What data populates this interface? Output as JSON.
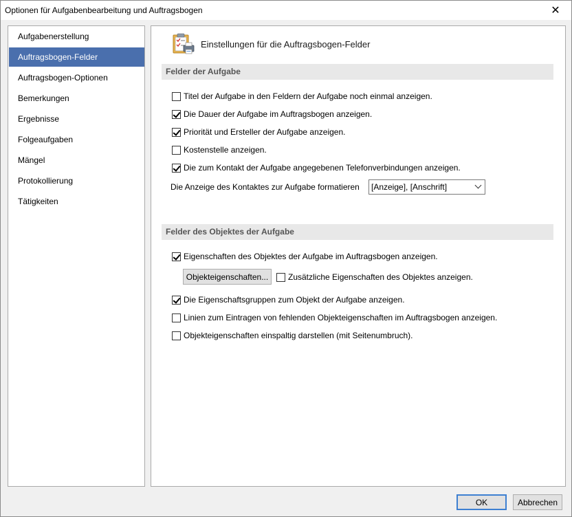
{
  "window": {
    "title": "Optionen für Aufgabenbearbeitung und Auftragsbogen",
    "close_glyph": "✕"
  },
  "sidebar": {
    "items": [
      {
        "label": "Aufgabenerstellung",
        "active": false
      },
      {
        "label": "Auftragsbogen-Felder",
        "active": true
      },
      {
        "label": "Auftragsbogen-Optionen",
        "active": false
      },
      {
        "label": "Bemerkungen",
        "active": false
      },
      {
        "label": "Ergebnisse",
        "active": false
      },
      {
        "label": "Folgeaufgaben",
        "active": false
      },
      {
        "label": "Mängel",
        "active": false
      },
      {
        "label": "Protokollierung",
        "active": false
      },
      {
        "label": "Tätigkeiten",
        "active": false
      }
    ]
  },
  "content": {
    "header_icon": "clipboard-printer-icon",
    "title": "Einstellungen für die Auftragsbogen-Felder",
    "section1": {
      "title": "Felder der Aufgabe",
      "checkboxes": [
        {
          "label": "Titel der Aufgabe in den Feldern der Aufgabe noch einmal anzeigen.",
          "checked": false
        },
        {
          "label": "Die Dauer der Aufgabe im Auftragsbogen anzeigen.",
          "checked": true
        },
        {
          "label": "Priorität und Ersteller der Aufgabe anzeigen.",
          "checked": true
        },
        {
          "label": "Kostenstelle anzeigen.",
          "checked": false
        },
        {
          "label": "Die zum Kontakt der Aufgabe angegebenen Telefonverbindungen anzeigen.",
          "checked": true
        }
      ],
      "format_label": "Die Anzeige des Kontaktes zur Aufgabe formatieren",
      "format_value": "[Anzeige], [Anschrift]"
    },
    "section2": {
      "title": "Felder des Objektes der Aufgabe",
      "cb_eigenschaften": {
        "label": "Eigenschaften des Objektes der Aufgabe im Auftragsbogen anzeigen.",
        "checked": true
      },
      "button_objekteigenschaften": "Objekteigenschaften...",
      "cb_zusaetzliche": {
        "label": "Zusätzliche Eigenschaften des Objektes anzeigen.",
        "checked": false
      },
      "cb_gruppen": {
        "label": "Die Eigenschaftsgruppen zum Objekt der Aufgabe anzeigen.",
        "checked": true
      },
      "cb_linien": {
        "label": "Linien zum Eintragen von fehlenden Objekteigenschaften im Auftragsbogen anzeigen.",
        "checked": false
      },
      "cb_einspaltig": {
        "label": "Objekteigenschaften einspaltig darstellen (mit Seitenumbruch).",
        "checked": false
      }
    }
  },
  "footer": {
    "ok_label": "OK",
    "cancel_label": "Abbrechen"
  },
  "colors": {
    "accent": "#4a6fad",
    "section_bg": "#e8e8e8",
    "default_button_border": "#3c7fd1"
  }
}
